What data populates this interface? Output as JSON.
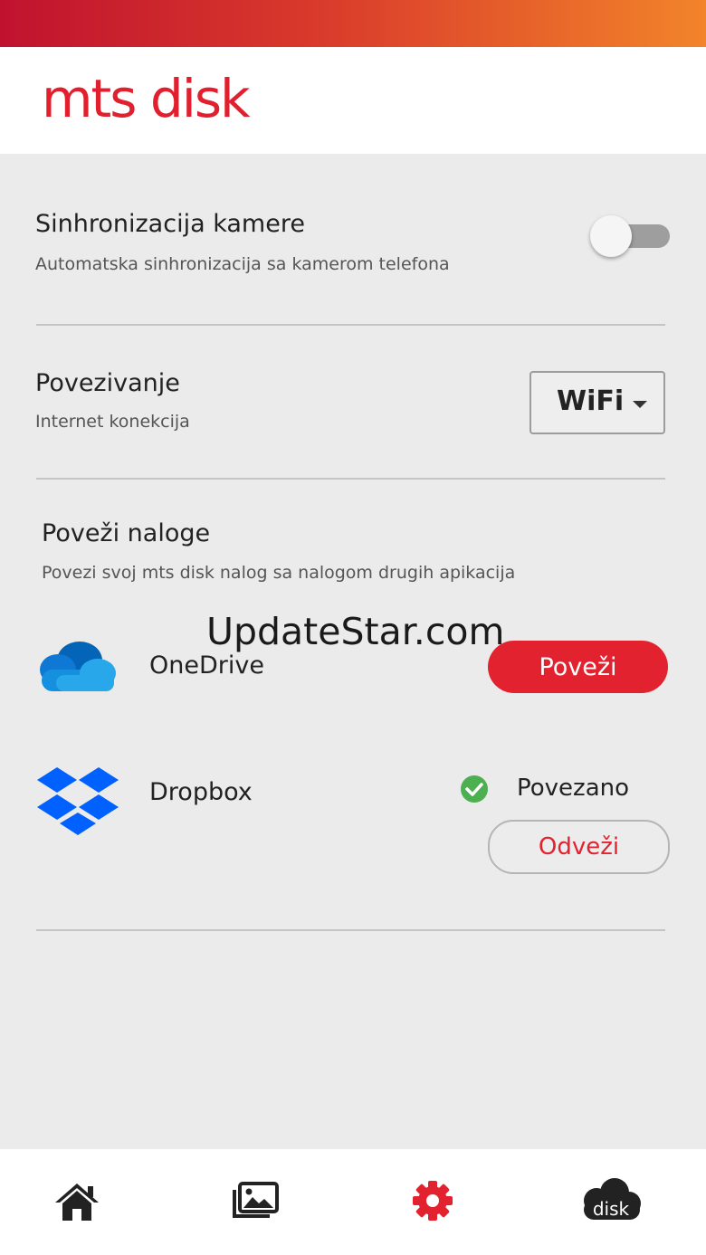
{
  "header": {
    "logo_text": "mts disk"
  },
  "camera_sync": {
    "title": "Sinhronizacija kamere",
    "subtitle": "Automatska sinhronizacija sa kamerom telefona",
    "enabled": false
  },
  "connection": {
    "title": "Povezivanje",
    "subtitle": "Internet konekcija",
    "selected": "WiFi"
  },
  "link_accounts": {
    "title": "Poveži naloge",
    "subtitle": "Povezi svoj mts disk nalog sa nalogom drugih apikacija",
    "accounts": [
      {
        "name": "OneDrive",
        "icon": "onedrive-icon",
        "button_label": "Poveži"
      },
      {
        "name": "Dropbox",
        "icon": "dropbox-icon",
        "status": "Povezano",
        "button_label": "Odveži"
      }
    ]
  },
  "watermark": "UpdateStar.com",
  "bottom_nav": {
    "items": [
      {
        "icon": "home-icon",
        "active": false
      },
      {
        "icon": "gallery-icon",
        "active": false
      },
      {
        "icon": "settings-gear-icon",
        "active": true
      },
      {
        "icon": "disk-cloud-icon",
        "label": "disk",
        "active": false
      }
    ]
  },
  "colors": {
    "brand_red": "#e3222f",
    "onedrive_blue": "#0f6cbd",
    "dropbox_blue": "#0061fe",
    "success_green": "#4caf50"
  }
}
